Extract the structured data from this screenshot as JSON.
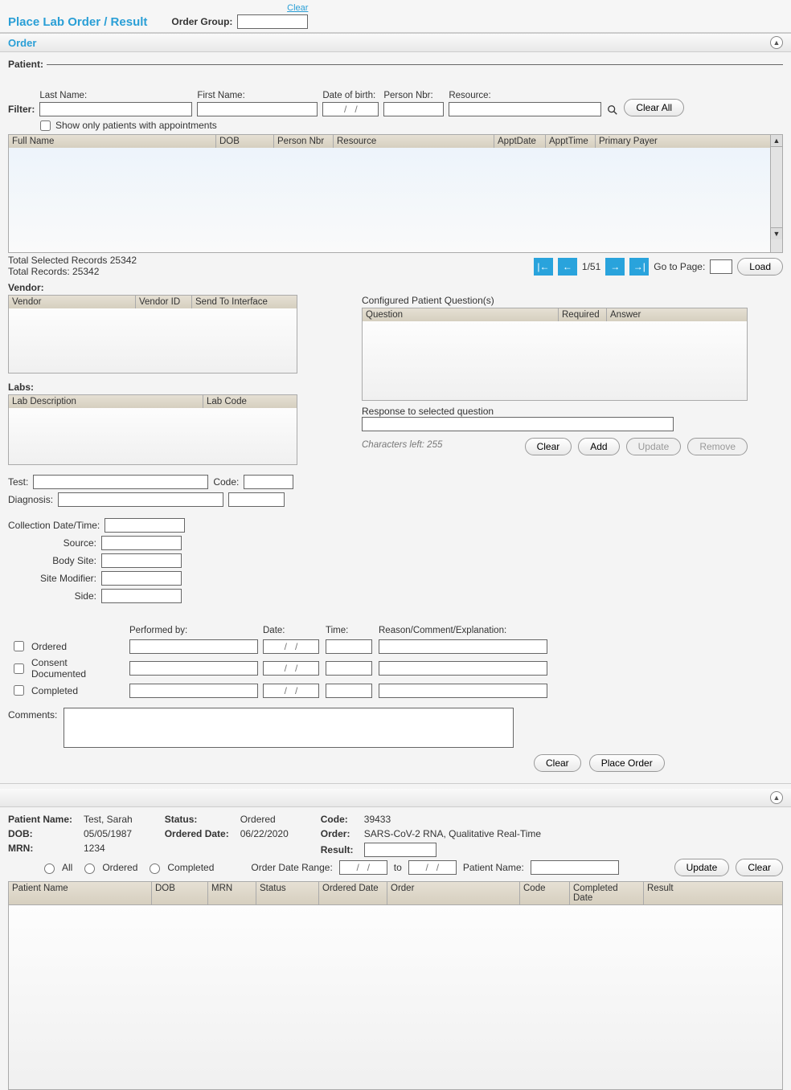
{
  "header": {
    "page_title": "Place Lab Order / Result",
    "order_group_label": "Order Group:",
    "clear_link": "Clear"
  },
  "order_section": {
    "title": "Order",
    "patient_label": "Patient:",
    "filter": {
      "label": "Filter:",
      "last_name": "Last Name:",
      "first_name": "First Name:",
      "dob": "Date of birth:",
      "dob_placeholder": "/   /",
      "person_nbr": "Person Nbr:",
      "resource": "Resource:",
      "clear_all": "Clear All",
      "show_only": "Show only patients with appointments"
    },
    "patient_grid_cols": {
      "full_name": "Full Name",
      "dob": "DOB",
      "person_nbr": "Person Nbr",
      "resource": "Resource",
      "appt_date": "ApptDate",
      "appt_time": "ApptTime",
      "primary_payer": "Primary Payer"
    },
    "totals": {
      "selected": "Total Selected Records 25342",
      "records": "Total Records: 25342"
    },
    "pager": {
      "page": "1/51",
      "goto_label": "Go to Page:",
      "load": "Load"
    },
    "vendor": {
      "label": "Vendor:",
      "cols": {
        "vendor": "Vendor",
        "vendor_id": "Vendor ID",
        "send": "Send To Interface"
      }
    },
    "labs": {
      "label": "Labs:",
      "cols": {
        "desc": "Lab Description",
        "code": "Lab Code"
      }
    },
    "questions": {
      "title": "Configured Patient Question(s)",
      "cols": {
        "question": "Question",
        "required": "Required",
        "answer": "Answer"
      },
      "response_label": "Response to selected question",
      "chars_left": "Characters left: 255",
      "clear": "Clear",
      "add": "Add",
      "update": "Update",
      "remove": "Remove"
    },
    "test_fields": {
      "test": "Test:",
      "code": "Code:",
      "diagnosis": "Diagnosis:",
      "collection": "Collection Date/Time:",
      "source": "Source:",
      "body_site": "Body Site:",
      "site_modifier": "Site Modifier:",
      "side": "Side:"
    },
    "status_checks": {
      "ordered": "Ordered",
      "consent": "Consent Documented",
      "completed": "Completed"
    },
    "perf_cols": {
      "performed_by": "Performed by:",
      "date": "Date:",
      "date_placeholder": "/   /",
      "time": "Time:",
      "reason": "Reason/Comment/Explanation:"
    },
    "comments_label": "Comments:",
    "actions": {
      "clear": "Clear",
      "place_order": "Place Order"
    }
  },
  "results_section": {
    "detail": {
      "patient_name_k": "Patient Name:",
      "patient_name_v": "Test, Sarah",
      "dob_k": "DOB:",
      "dob_v": "05/05/1987",
      "mrn_k": "MRN:",
      "mrn_v": "1234",
      "status_k": "Status:",
      "status_v": "Ordered",
      "ordered_date_k": "Ordered Date:",
      "ordered_date_v": "06/22/2020",
      "code_k": "Code:",
      "code_v": "39433",
      "order_k": "Order:",
      "order_v": "SARS-CoV-2 RNA, Qualitative Real-Time",
      "result_k": "Result:"
    },
    "filter": {
      "all": "All",
      "ordered": "Ordered",
      "completed": "Completed",
      "date_range": "Order Date Range:",
      "to": "to",
      "date_placeholder": "/   /",
      "patient_name": "Patient Name:",
      "update": "Update",
      "clear": "Clear"
    },
    "cols": {
      "patient_name": "Patient Name",
      "dob": "DOB",
      "mrn": "MRN",
      "status": "Status",
      "ordered_date": "Ordered Date",
      "order": "Order",
      "code": "Code",
      "completed_date": "Completed Date",
      "result": "Result"
    }
  }
}
